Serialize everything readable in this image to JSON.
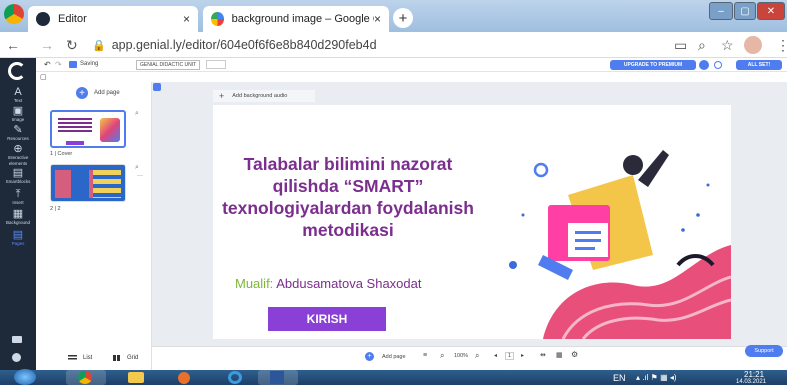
{
  "browser": {
    "tabs": [
      {
        "title": "Editor",
        "close": "×"
      },
      {
        "title": "background image – Google Qid",
        "close": "×"
      }
    ],
    "new_tab": "+",
    "url": "app.genial.ly/editor/604e0f6f6e8b840d290feb4d",
    "window_buttons": [
      "–",
      "▢",
      "✕"
    ]
  },
  "editor": {
    "status": "Saving",
    "unit_label": "GENIAL DIDACTIC UNIT",
    "upgrade_label": "UPGRADE TO PREMIUM",
    "all_set_label": "ALL SET!"
  },
  "rail": {
    "items": [
      {
        "icon": "A",
        "label": "Text"
      },
      {
        "icon": "▣",
        "label": "Image"
      },
      {
        "icon": "✎",
        "label": "Resources"
      },
      {
        "icon": "⊕",
        "label": "Interactive elements"
      },
      {
        "icon": "▤",
        "label": "Smartblocks"
      },
      {
        "icon": "⤒",
        "label": "Insert"
      },
      {
        "icon": "▦",
        "label": "Background"
      },
      {
        "icon": "▤",
        "label": "Pages"
      }
    ]
  },
  "pages_panel": {
    "add_page": "Add page",
    "page1_label": "1 | Cover",
    "page2_label": "2 | 2",
    "list_label": "List",
    "grid_label": "Grid"
  },
  "canvas": {
    "add_audio": "Add background audio",
    "slide_title": "Talabalar bilimini nazorat qilishda “SMART” texnologiyalardan foydalanish metodikasi",
    "author_prefix": "Mualif:",
    "author_name": "Abdusamatova Shaxodat",
    "button_label": "KIRISH"
  },
  "bottom_bar": {
    "add_page": "Add page",
    "zoom": "100%",
    "page_indicator": "1",
    "support": "Support"
  },
  "taskbar": {
    "lang": "EN",
    "time": "21:21",
    "date": "14.03.2021"
  },
  "colors": {
    "title": "#7b2e8e",
    "author_prefix": "#7fb63a",
    "author_name": "#7b2e8e",
    "button": "#8a3fd6",
    "accent": "#4f7df0"
  }
}
